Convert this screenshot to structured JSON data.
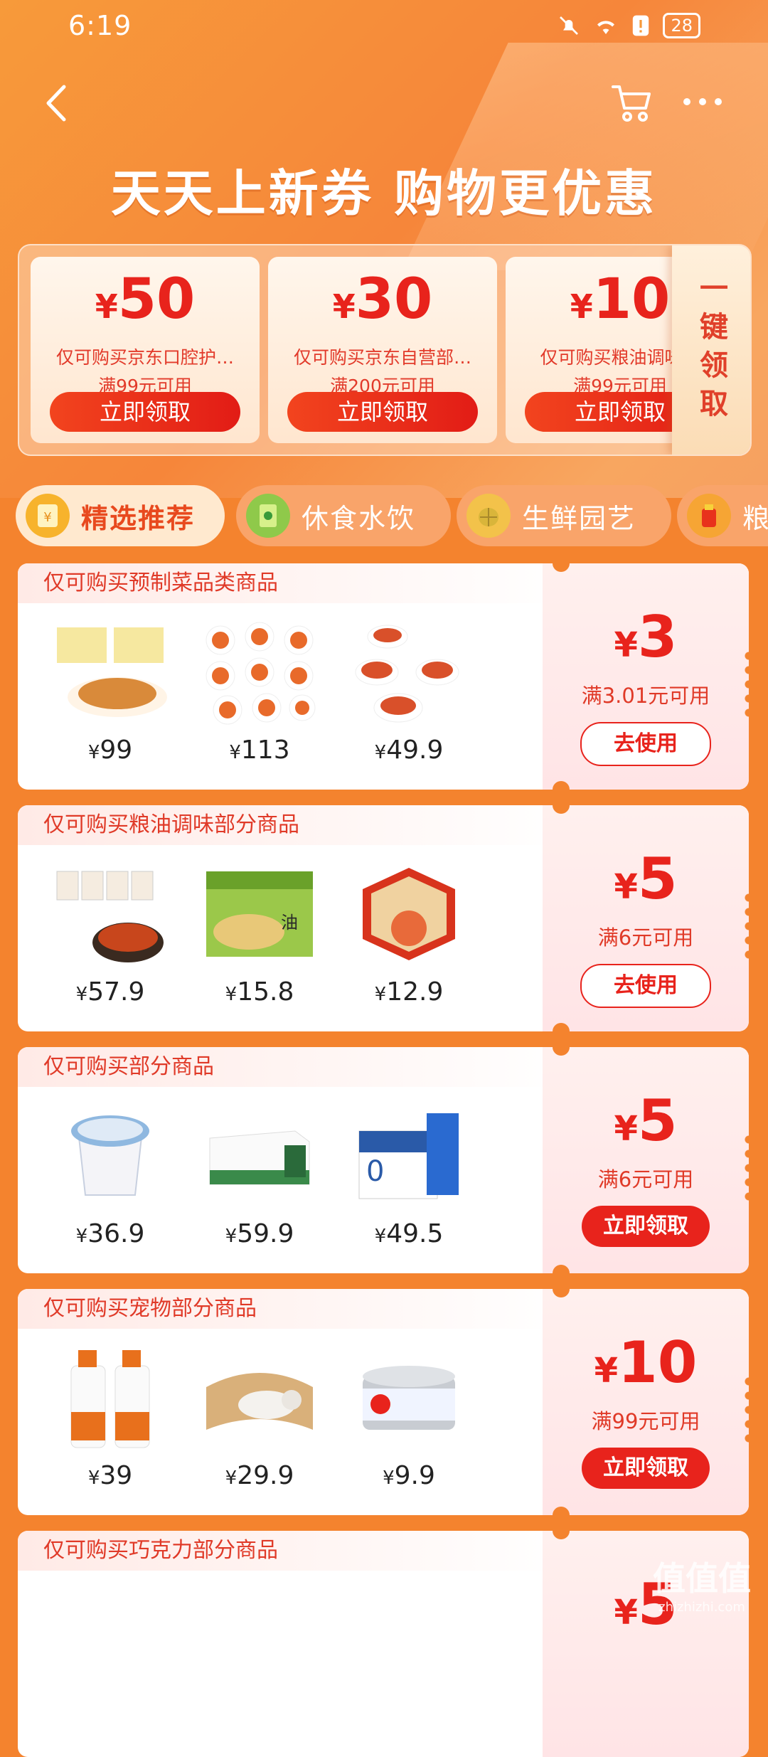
{
  "status_bar": {
    "time": "6:19",
    "battery": "28"
  },
  "header": {
    "title": "天天上新券 购物更优惠"
  },
  "top_coupons": [
    {
      "amount": "50",
      "desc": "仅可购买京东口腔护…",
      "condition": "满99元可用",
      "button": "立即领取"
    },
    {
      "amount": "30",
      "desc": "仅可购买京东自营部…",
      "condition": "满200元可用",
      "button": "立即领取"
    },
    {
      "amount": "10",
      "desc": "仅可购买粮油调味…",
      "condition": "满99元可用",
      "button": "立即领取"
    }
  ],
  "one_key_claim": "一键领取",
  "currency": "¥",
  "tabs": [
    {
      "label": "精选推荐",
      "icon": "coupon-icon",
      "active": true
    },
    {
      "label": "休食水饮",
      "icon": "snack-icon",
      "active": false
    },
    {
      "label": "生鲜园艺",
      "icon": "durian-icon",
      "active": false
    },
    {
      "label": "粮",
      "icon": "grain-icon",
      "active": false
    }
  ],
  "coupon_cards": [
    {
      "title": "仅可购买预制菜品类商品",
      "amount": "3",
      "condition": "满3.01元可用",
      "button": "去使用",
      "products": [
        {
          "price": "99"
        },
        {
          "price": "113"
        },
        {
          "price": "49.9"
        }
      ]
    },
    {
      "title": "仅可购买粮油调味部分商品",
      "amount": "5",
      "condition": "满6元可用",
      "button": "去使用",
      "products": [
        {
          "price": "57.9"
        },
        {
          "price": "15.8"
        },
        {
          "price": "12.9"
        }
      ]
    },
    {
      "title": "仅可购买部分商品",
      "amount": "5",
      "condition": "满6元可用",
      "button": "立即领取",
      "products": [
        {
          "price": "36.9"
        },
        {
          "price": "59.9"
        },
        {
          "price": "49.5"
        }
      ]
    },
    {
      "title": "仅可购买宠物部分商品",
      "amount": "10",
      "condition": "满99元可用",
      "button": "立即领取",
      "products": [
        {
          "price": "39"
        },
        {
          "price": "29.9"
        },
        {
          "price": "9.9"
        }
      ]
    },
    {
      "title": "仅可购买巧克力部分商品",
      "amount": "5"
    }
  ],
  "watermark": {
    "logo": "值值值",
    "url": "zhizhizhi.com"
  }
}
